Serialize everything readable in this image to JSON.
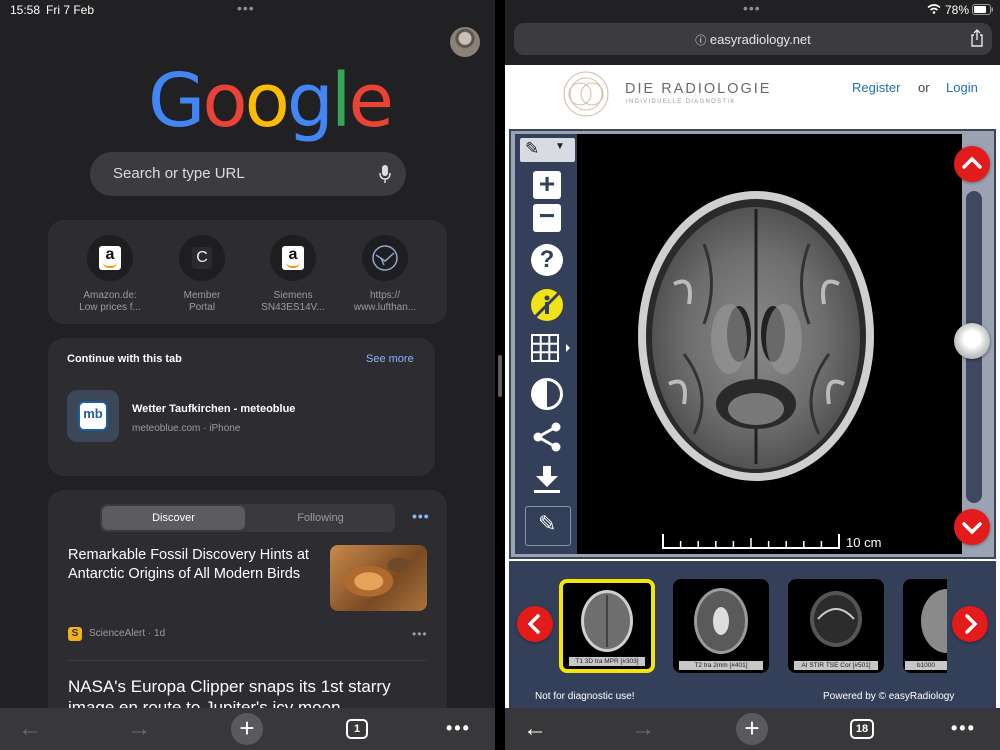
{
  "status": {
    "time": "15:58",
    "date": "Fri 7 Feb",
    "battery": "78%"
  },
  "left": {
    "logo_letters": [
      "G",
      "o",
      "o",
      "g",
      "l",
      "e"
    ],
    "logo_colors": [
      "#4285f4",
      "#ea4335",
      "#fbbc05",
      "#4285f4",
      "#34a853",
      "#ea4335"
    ],
    "search_placeholder": "Search or type URL",
    "shortcuts": [
      {
        "label1": "Amazon.de:",
        "label2": "Low prices f...",
        "icon": "amazon-icon"
      },
      {
        "label1": "Member",
        "label2": "Portal",
        "icon": "letter-c-icon",
        "letter": "C"
      },
      {
        "label1": "Siemens",
        "label2": "SN43ES14V...",
        "icon": "amazon-icon"
      },
      {
        "label1": "https://",
        "label2": "www.lufthan...",
        "icon": "lufthansa-icon"
      }
    ],
    "amazon_letter": "a",
    "continue": {
      "heading": "Continue with this tab",
      "see_more": "See more",
      "icon_text": "mb",
      "title": "Wetter Taufkirchen - meteoblue",
      "subtitle": "meteoblue.com · iPhone"
    },
    "feed": {
      "tabs": [
        "Discover",
        "Following"
      ],
      "article1": {
        "title": "Remarkable Fossil Discovery Hints at Antarctic Origins of All Modern Birds",
        "source_icon": "S",
        "source": "ScienceAlert · 1d"
      },
      "article2": {
        "title": "NASA's Europa Clipper snaps its 1st starry image en route to Jupiter's icy moon"
      }
    },
    "toolbar": {
      "tab_count": "1"
    }
  },
  "right": {
    "url": "easyradiology.net",
    "brand": "DIE RADIOLOGIE",
    "brand_sub": "INDIVIDUELLE DIAGNOSTIK",
    "register": "Register",
    "or": "or",
    "login": "Login",
    "scale_label": "10 cm",
    "thumbnails": [
      {
        "caption": "T1 3D tra MPR [#303]",
        "selected": true
      },
      {
        "caption": "T2 tra 2mm [#401]",
        "selected": false
      },
      {
        "caption": "AI STIR TSE Cor [#501]",
        "selected": false
      },
      {
        "caption": "b1000",
        "selected": false
      }
    ],
    "not_diagnostic": "Not for diagnostic use!",
    "powered_by": "Powered by © easyRadiology",
    "toolbar": {
      "tab_count": "18"
    },
    "colors": {
      "accent": "#e41b1b",
      "selection": "#f5e60a",
      "link": "#1f6fb3"
    }
  }
}
